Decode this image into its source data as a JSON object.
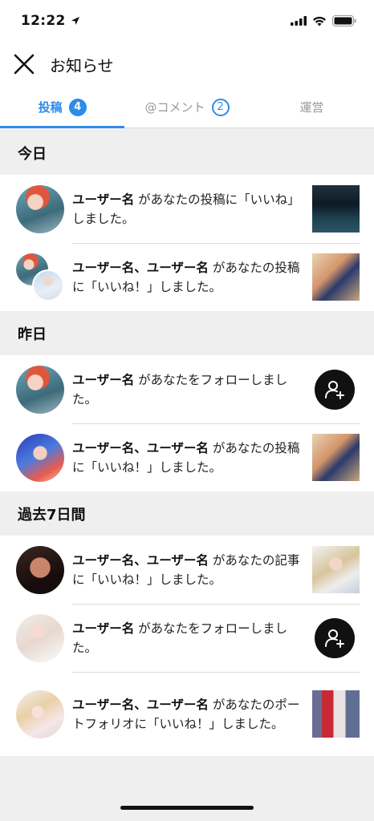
{
  "status_bar": {
    "time": "12:22"
  },
  "header": {
    "title": "お知らせ"
  },
  "tabs": [
    {
      "label": "投稿",
      "badge": "4",
      "active": true
    },
    {
      "label": "@コメント",
      "badge": "2",
      "active": false
    },
    {
      "label": "運営",
      "badge": "",
      "active": false
    }
  ],
  "sections": [
    {
      "title": "今日",
      "items": [
        {
          "user": "ユーザー名",
          "message": " があなたの投稿に「いいね」しました。"
        },
        {
          "user": "ユーザー名、ユーザー名",
          "message": " があなたの投稿に「いいね！」しました。"
        }
      ]
    },
    {
      "title": "昨日",
      "items": [
        {
          "user": "ユーザー名",
          "message": " があなたをフォローしました。"
        },
        {
          "user": "ユーザー名、ユーザー名",
          "message": " があなたの投稿に「いいね！」しました。"
        }
      ]
    },
    {
      "title": "過去7日間",
      "items": [
        {
          "user": "ユーザー名、ユーザー名",
          "message": " があなたの記事に「いいね！」しました。"
        },
        {
          "user": "ユーザー名",
          "message": " があなたをフォローしました。"
        },
        {
          "user": "ユーザー名、ユーザー名",
          "message": " があなたのポートフォリオに「いいね！」しました。"
        }
      ]
    }
  ],
  "colors": {
    "accent": "#2d8ce8",
    "section_bg": "#efefef",
    "follow_button": "#111111"
  },
  "icons": {
    "close": "close-icon",
    "follow": "add-user-icon",
    "location": "location-arrow-icon"
  }
}
